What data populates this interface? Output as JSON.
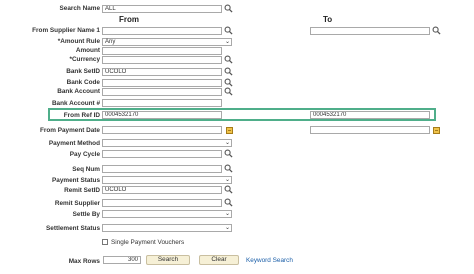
{
  "columns": {
    "from": "From",
    "to": "To"
  },
  "fields": {
    "search_name": {
      "label": "Search Name",
      "value": "ALL"
    },
    "from_supplier_name": {
      "label": "From Supplier Name 1"
    },
    "amount_rule": {
      "label": "*Amount Rule",
      "value": "Any"
    },
    "amount": {
      "label": "Amount"
    },
    "currency": {
      "label": "*Currency"
    },
    "bank_setid": {
      "label": "Bank SetID",
      "value": "UCOLO"
    },
    "bank_code": {
      "label": "Bank Code"
    },
    "bank_account": {
      "label": "Bank Account"
    },
    "bank_account_num": {
      "label": "Bank Account #"
    },
    "from_ref_id": {
      "label": "From Ref ID",
      "from_value": "0004532170",
      "to_value": "0004532170"
    },
    "from_payment_date": {
      "label": "From Payment Date"
    },
    "payment_method": {
      "label": "Payment Method"
    },
    "pay_cycle": {
      "label": "Pay Cycle"
    },
    "seq_num": {
      "label": "Seq Num"
    },
    "payment_status": {
      "label": "Payment Status"
    },
    "remit_setid": {
      "label": "Remit SetID",
      "value": "UCOLO"
    },
    "remit_supplier": {
      "label": "Remit Supplier"
    },
    "settle_by": {
      "label": "Settle By"
    },
    "settlement_status": {
      "label": "Settlement Status"
    }
  },
  "single_payment_vouchers": {
    "label": "Single Payment Vouchers",
    "checked": false
  },
  "max_rows": {
    "label": "Max Rows",
    "value": "300"
  },
  "buttons": {
    "search": "Search",
    "clear": "Clear"
  },
  "keyword_search": "Keyword Search",
  "icons": {
    "lookup": "magnifier-icon",
    "calendar": "calendar-icon"
  },
  "colors": {
    "highlight": "#4fae8a",
    "link": "#1a5ea8",
    "button_bg": "#f6f0d6"
  }
}
